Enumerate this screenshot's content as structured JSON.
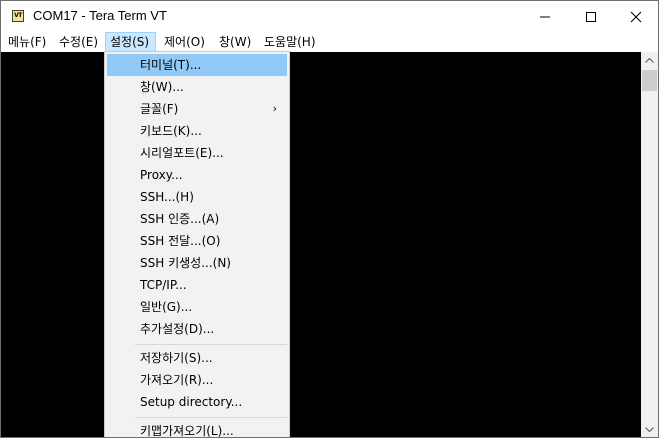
{
  "window": {
    "title": "COM17 - Tera Term VT",
    "icon_text": "VT"
  },
  "titlebar_buttons": {
    "minimize": "minimize-icon",
    "maximize": "maximize-icon",
    "close": "close-icon"
  },
  "menubar": {
    "items": [
      {
        "label": "메뉴(F)"
      },
      {
        "label": "수정(E)"
      },
      {
        "label": "설정(S)"
      },
      {
        "label": "제어(O)"
      },
      {
        "label": "창(W)"
      },
      {
        "label": "도움말(H)"
      }
    ],
    "active_index": 2
  },
  "dropdown": {
    "items": [
      {
        "label": "터미널(T)..."
      },
      {
        "label": "창(W)..."
      },
      {
        "label": "글꼴(F)",
        "submenu_arrow": "›"
      },
      {
        "label": "키보드(K)..."
      },
      {
        "label": "시리얼포트(E)..."
      },
      {
        "label": "Proxy..."
      },
      {
        "label": "SSH...(H)"
      },
      {
        "label": "SSH 인증...(A)"
      },
      {
        "label": "SSH 전달...(O)"
      },
      {
        "label": "SSH 키생성...(N)"
      },
      {
        "label": "TCP/IP..."
      },
      {
        "label": "일반(G)..."
      },
      {
        "label": "추가설정(D)..."
      },
      {
        "label": "저장하기(S)..."
      },
      {
        "label": "가져오기(R)..."
      },
      {
        "label": "Setup directory..."
      },
      {
        "label": "키맵가져오기(L)..."
      }
    ],
    "highlighted_index": 0
  },
  "colors": {
    "terminal_bg": "#000000",
    "menu_highlight": "#91c9f7",
    "menubar_active": "#cce8ff"
  }
}
